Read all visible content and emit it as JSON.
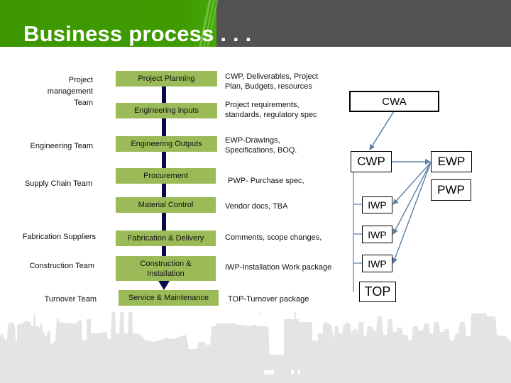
{
  "header": {
    "title": "Business process . . ."
  },
  "colors": {
    "header_green": "#3f9b00",
    "header_grey": "#525252",
    "step_green": "#9bbb59",
    "spine_navy": "#0a0a4a",
    "connector_blue": "#5b7fa8",
    "skyline_grey": "#e4e4e4"
  },
  "teams": [
    {
      "label": "Project management Team",
      "lines": [
        "Project",
        "management",
        "Team"
      ]
    },
    {
      "label": "Engineering Team"
    },
    {
      "label": "Supply Chain Team"
    },
    {
      "label": "Fabrication Suppliers"
    },
    {
      "label": "Construction Team"
    },
    {
      "label": "Turnover Team"
    }
  ],
  "steps": [
    {
      "label": "Project Planning"
    },
    {
      "label": "Engineering inputs"
    },
    {
      "label": "Engineering Outputs"
    },
    {
      "label": "Procurement"
    },
    {
      "label": "Material Control"
    },
    {
      "label": "Fabrication & Delivery"
    },
    {
      "label": "Construction & Installation",
      "lines": [
        "Construction &",
        "Installation"
      ]
    },
    {
      "label": "Service & Maintenance"
    }
  ],
  "deliverables": [
    {
      "lines": [
        "CWP, Deliverables, Project",
        "Plan, Budgets, resources"
      ]
    },
    {
      "lines": [
        "Project requirements,",
        "standards, regulatory spec"
      ]
    },
    {
      "lines": [
        "EWP-Drawings,",
        "Specifications, BOQ."
      ]
    },
    {
      "lines": [
        "PWP- Purchase spec,"
      ]
    },
    {
      "lines": [
        "Vendor docs, TBA"
      ]
    },
    {
      "lines": [
        "Comments, scope changes,"
      ]
    },
    {
      "lines": [
        "IWP-Installation Work package"
      ]
    },
    {
      "lines": [
        "TOP-Turnover package"
      ]
    }
  ],
  "work_packages": {
    "cwa": "CWA",
    "cwp": "CWP",
    "ewp": "EWP",
    "pwp": "PWP",
    "iwp": [
      "IWP",
      "IWP",
      "IWP"
    ],
    "top": "TOP"
  }
}
